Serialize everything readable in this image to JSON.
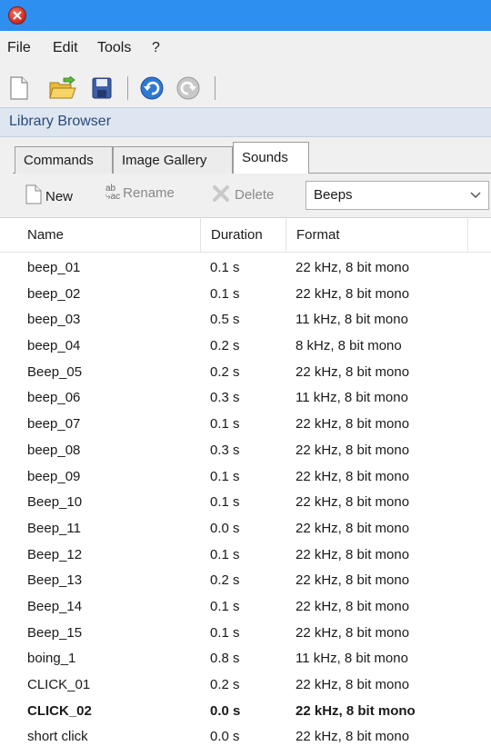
{
  "menu": [
    "File",
    "Edit",
    "Tools",
    "?"
  ],
  "toolbar_icons": [
    "new-document-icon",
    "open-folder-icon",
    "save-icon",
    "undo-icon",
    "redo-icon"
  ],
  "panel_title": "Library Browser",
  "tabs": [
    {
      "label": "Commands",
      "active": false
    },
    {
      "label": "Image Gallery",
      "active": false
    },
    {
      "label": "Sounds",
      "active": true
    }
  ],
  "list_toolbar": {
    "new_label": "New",
    "rename_label": "Rename",
    "delete_label": "Delete",
    "category_value": "Beeps"
  },
  "columns": [
    "Name",
    "Duration",
    "Format"
  ],
  "rows": [
    {
      "name": "beep_01",
      "duration": "0.1 s",
      "format": "22 kHz, 8 bit mono"
    },
    {
      "name": "beep_02",
      "duration": "0.1 s",
      "format": "22 kHz, 8 bit mono"
    },
    {
      "name": "beep_03",
      "duration": "0.5 s",
      "format": "11 kHz, 8 bit mono"
    },
    {
      "name": "beep_04",
      "duration": "0.2 s",
      "format": "8 kHz, 8 bit mono"
    },
    {
      "name": "Beep_05",
      "duration": "0.2 s",
      "format": "22 kHz, 8 bit mono"
    },
    {
      "name": "beep_06",
      "duration": "0.3 s",
      "format": "11 kHz, 8 bit mono"
    },
    {
      "name": "beep_07",
      "duration": "0.1 s",
      "format": "22 kHz, 8 bit mono"
    },
    {
      "name": "beep_08",
      "duration": "0.3 s",
      "format": "22 kHz, 8 bit mono"
    },
    {
      "name": "beep_09",
      "duration": "0.1 s",
      "format": "22 kHz, 8 bit mono"
    },
    {
      "name": "Beep_10",
      "duration": "0.1 s",
      "format": "22 kHz, 8 bit mono"
    },
    {
      "name": "Beep_11",
      "duration": "0.0 s",
      "format": "22 kHz, 8 bit mono"
    },
    {
      "name": "Beep_12",
      "duration": "0.1 s",
      "format": "22 kHz, 8 bit mono"
    },
    {
      "name": "Beep_13",
      "duration": "0.2 s",
      "format": "22 kHz, 8 bit mono"
    },
    {
      "name": "Beep_14",
      "duration": "0.1 s",
      "format": "22 kHz, 8 bit mono"
    },
    {
      "name": "Beep_15",
      "duration": "0.1 s",
      "format": "22 kHz, 8 bit mono"
    },
    {
      "name": "boing_1",
      "duration": "0.8 s",
      "format": "11 kHz, 8 bit mono"
    },
    {
      "name": "CLICK_01",
      "duration": "0.2 s",
      "format": "22 kHz, 8 bit mono"
    },
    {
      "name": "CLICK_02",
      "duration": "0.0 s",
      "format": "22 kHz, 8 bit mono",
      "bold": true
    },
    {
      "name": "short click",
      "duration": "0.0 s",
      "format": "22 kHz, 8 bit mono"
    }
  ],
  "colors": {
    "titlebar": "#2d8ff0",
    "panel_title_bg": "#dde6f1",
    "panel_title_text": "#2b4a7a"
  }
}
